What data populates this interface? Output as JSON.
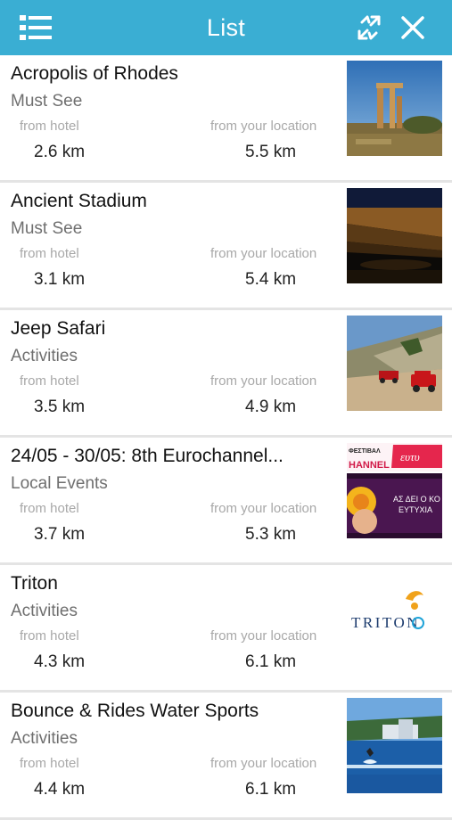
{
  "header": {
    "title": "List",
    "menu_icon": "menu-list-icon",
    "sort_icon": "sort-arrows-icon",
    "close_icon": "close-icon",
    "background": "#3aaed3"
  },
  "labels": {
    "from_hotel": "from hotel",
    "from_location": "from your location"
  },
  "items": [
    {
      "name": "Acropolis of Rhodes",
      "category": "Must See",
      "from_hotel": "2.6 km",
      "from_location": "5.5 km",
      "thumbnail": "ruins-photo"
    },
    {
      "name": "Ancient Stadium",
      "category": "Must See",
      "from_hotel": "3.1 km",
      "from_location": "5.4 km",
      "thumbnail": "stadium-night-photo"
    },
    {
      "name": "Jeep Safari",
      "category": "Activities",
      "from_hotel": "3.5 km",
      "from_location": "4.9 km",
      "thumbnail": "jeeps-photo"
    },
    {
      "name": "24/05 - 30/05: 8th Eurochannel...",
      "category": "Local Events",
      "from_hotel": "3.7 km",
      "from_location": "5.3 km",
      "thumbnail": "festival-poster",
      "poster_text": {
        "top_left": "ΦΕΣΤΙΒΑΛ",
        "channel": "HANNEL",
        "brand": "ευτυ",
        "line1": "ΑΣ ΔΕΙ Ο ΚΟ",
        "line2": "ΕΥΤΥΧΙΑ"
      }
    },
    {
      "name": "Triton",
      "category": "Activities",
      "from_hotel": "4.3 km",
      "from_location": "6.1 km",
      "thumbnail": "triton-logo",
      "logo_text": "TRITON"
    },
    {
      "name": "Bounce & Rides Water Sports",
      "category": "Activities",
      "from_hotel": "4.4 km",
      "from_location": "6.1 km",
      "thumbnail": "watersports-photo"
    }
  ]
}
